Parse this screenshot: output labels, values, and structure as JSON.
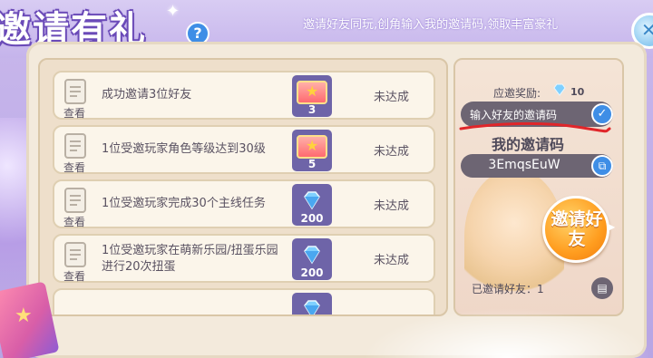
{
  "header": {
    "title": "邀请有礼",
    "subtitle": "邀请好友同玩,创角输入我的邀请码,领取丰富豪礼",
    "help_label": "?"
  },
  "tasks": [
    {
      "view_label": "查看",
      "text": "成功邀请3位好友",
      "reward_type": "ticket",
      "reward_count": "3",
      "status": "未达成"
    },
    {
      "view_label": "查看",
      "text": "1位受邀玩家角色等级达到30级",
      "reward_type": "ticket",
      "reward_count": "5",
      "status": "未达成"
    },
    {
      "view_label": "查看",
      "text": "1位受邀玩家完成30个主线任务",
      "reward_type": "gem",
      "reward_count": "200",
      "status": "未达成"
    },
    {
      "view_label": "查看",
      "text": "1位受邀玩家在萌新乐园/扭蛋乐园进行20次扭蛋",
      "reward_type": "gem",
      "reward_count": "200",
      "status": "未达成"
    }
  ],
  "side": {
    "reward_label": "应邀奖励:",
    "reward_value": "10",
    "input_placeholder": "输入好友的邀请码",
    "my_code_title": "我的邀请码",
    "my_code": "3EmqsEuW",
    "invite_button": "邀请好友",
    "invited_label": "已邀请好友：",
    "invited_count": "1"
  },
  "colors": {
    "accent_blue": "#3f8ee6",
    "invite_orange": "#ff9d1f",
    "reward_bg": "#6e64a8"
  }
}
